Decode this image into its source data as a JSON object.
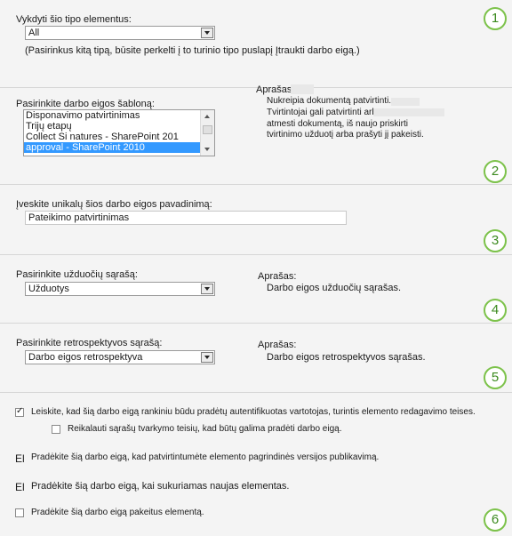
{
  "section1": {
    "label": "Vykdyti šio tipo elementus:",
    "select_value": "All",
    "note": "(Pasirinkus kitą tipą, būsite perkelti į to turinio tipo puslapį Įtraukti darbo eigą.)",
    "step": "1"
  },
  "section2": {
    "label": "Pasirinkite darbo eigos šabloną:",
    "templates": [
      "Disponavimo patvirtinimas",
      "Trijų etapų",
      "Collect Si natures - SharePoint 201",
      "approval - SharePoint 2010"
    ],
    "desc_label": "Aprašas:",
    "desc_lines": [
      "Nukreipia dokumentą patvirtinti.",
      "Tvirtintojai gali patvirtinti arba",
      "atmesti dokumentą, iš naujo priskirti",
      "tvirtinimo užduotį arba prašyti jį pakeisti."
    ],
    "step": "2"
  },
  "section3": {
    "label": "Įveskite unikalų šios darbo eigos pavadinimą:",
    "name_value": "Pateikimo patvirtinimas",
    "step": "3"
  },
  "section4": {
    "label": "Pasirinkite užduočių sąrašą:",
    "select_value": "Užduotys",
    "desc_label": "Aprašas:",
    "desc": "Darbo eigos užduočių sąrašas.",
    "step": "4"
  },
  "section5": {
    "label": "Pasirinkite retrospektyvos sąrašą:",
    "select_value": "Darbo eigos retrospektyva",
    "desc_label": "Aprašas:",
    "desc": "Darbo eigos retrospektyvos sąrašas.",
    "step": "5"
  },
  "section6": {
    "allow_manual": "Leiskite, kad šią darbo eigą rankiniu būdu pradėtų autentifikuotas vartotojas, turintis elemento redagavimo teises.",
    "require_manage": "Reikalauti sąrašų tvarkymo teisių, kad būtų galima pradėti darbo eigą.",
    "start_publish_marker": "El",
    "start_publish": "Pradėkite šią darbo eigą, kad patvirtintumėte elemento pagrindinės versijos publikavimą.",
    "start_create_marker": "El",
    "start_create": "Pradėkite šią darbo eigą, kai sukuriamas naujas elementas.",
    "start_change": "Pradėkite šią darbo eigą pakeitus elementą.",
    "step": "6"
  }
}
